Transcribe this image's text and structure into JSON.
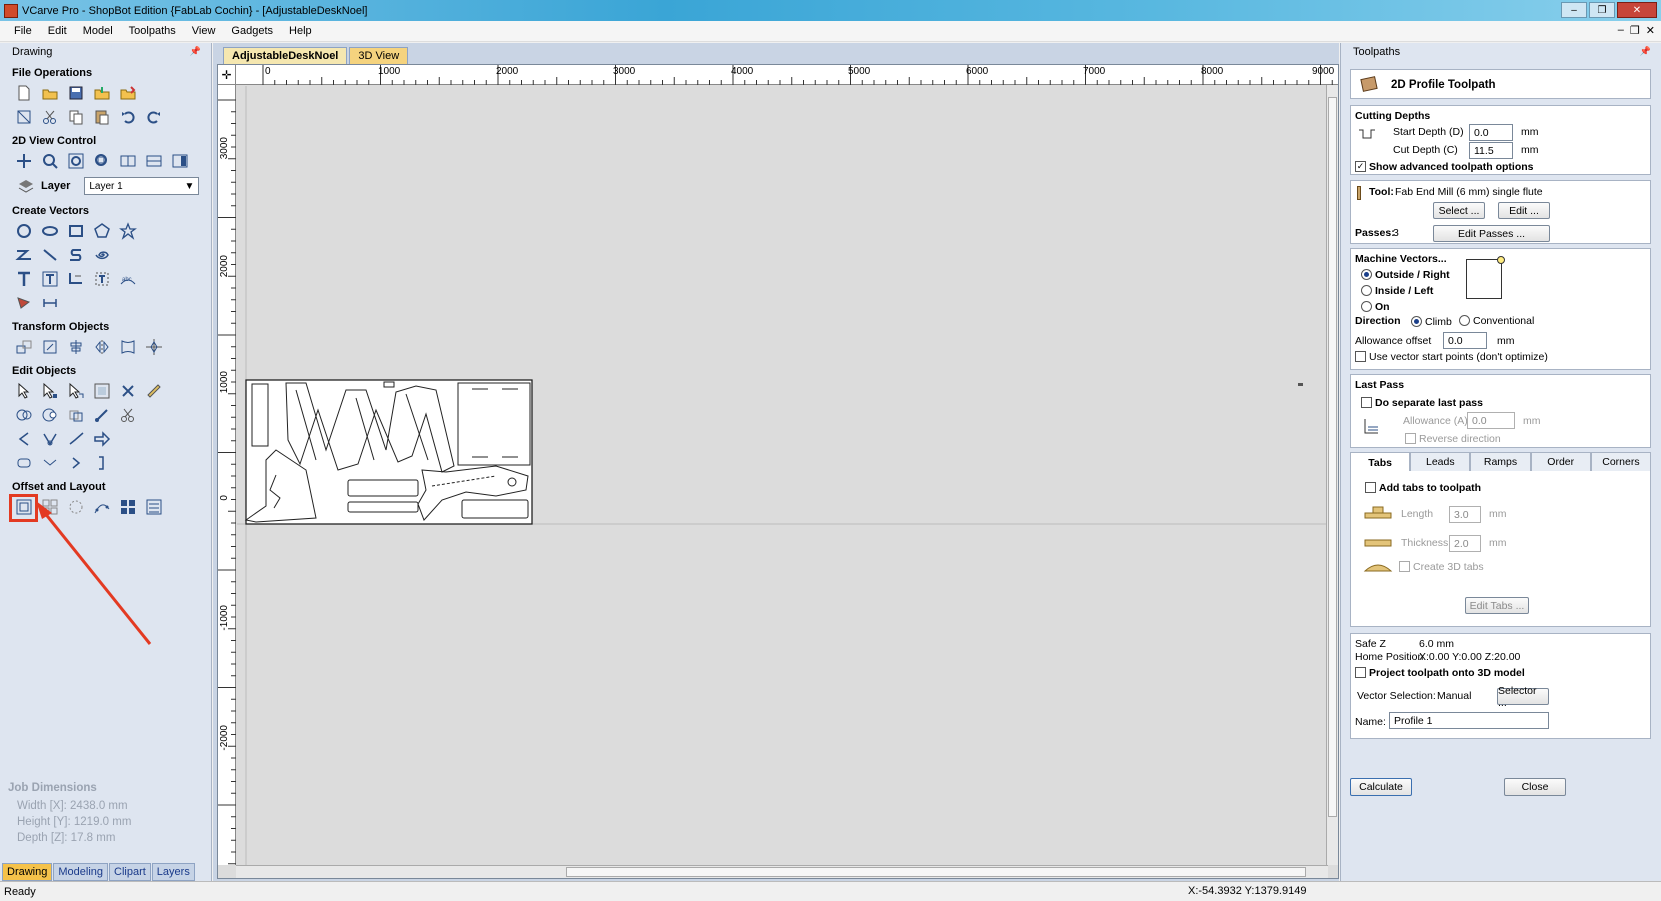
{
  "window": {
    "title": "VCarve Pro - ShopBot Edition {FabLab Cochin} - [AdjustableDeskNoel]",
    "minimize": "–",
    "maximize": "❐",
    "close": "✕"
  },
  "menubar": {
    "items": [
      "File",
      "Edit",
      "Model",
      "Toolpaths",
      "View",
      "Gadgets",
      "Help"
    ],
    "mdi_minimize": "–",
    "mdi_restore": "❐",
    "mdi_close": "✕"
  },
  "left_panel": {
    "header": "Drawing",
    "pin": "📌",
    "sections": {
      "file_operations": "File Operations",
      "view_control": "2D View Control",
      "create_vectors": "Create Vectors",
      "transform_objects": "Transform Objects",
      "edit_objects": "Edit Objects",
      "offset_layout": "Offset and Layout"
    },
    "layer_label": "Layer",
    "layer_value": "Layer 1",
    "job_dimensions": {
      "title": "Job Dimensions",
      "width": "Width  [X]: 2438.0 mm",
      "height": "Height [Y]: 1219.0 mm",
      "depth": "Depth  [Z]: 17.8 mm"
    },
    "tabs": [
      "Drawing",
      "Modeling",
      "Clipart",
      "Layers"
    ]
  },
  "workspace": {
    "doc_tabs": [
      "AdjustableDeskNoel",
      "3D View"
    ],
    "hruler_labels": [
      "0",
      "1000",
      "2000",
      "3000",
      "4000",
      "5000",
      "6000",
      "7000",
      "8000",
      "9000"
    ],
    "vruler_labels": [
      "3000",
      "2000",
      "1000",
      "0",
      "-1000",
      "-2000"
    ],
    "corner_symbol": "✛"
  },
  "right_panel": {
    "header": "Toolpaths",
    "pin": "📌",
    "toolpath_title": "2D Profile Toolpath",
    "cutting_depths": {
      "title": "Cutting Depths",
      "start_label": "Start Depth (D)",
      "start_value": "0.0",
      "cut_label": "Cut Depth (C)",
      "cut_value": "11.5",
      "unit": "mm",
      "advanced_label": "Show advanced toolpath options",
      "advanced_checked": "✓"
    },
    "tool": {
      "label": "Tool:",
      "name": "Fab End Mill (6 mm) single flute",
      "select_btn": "Select ...",
      "edit_btn": "Edit ...",
      "passes_label": "Passes:",
      "passes_value": "3",
      "edit_passes_btn": "Edit Passes ..."
    },
    "machine_vectors": {
      "title": "Machine Vectors...",
      "outside": "Outside / Right",
      "inside": "Inside / Left",
      "on": "On",
      "direction_label": "Direction",
      "climb": "Climb",
      "conventional": "Conventional",
      "allowance_label": "Allowance offset",
      "allowance_value": "0.0",
      "unit": "mm",
      "start_points": "Use vector start points (don't optimize)"
    },
    "last_pass": {
      "title": "Last Pass",
      "separate": "Do separate last pass",
      "allowance_label": "Allowance (A)",
      "allowance_value": "0.0",
      "unit": "mm",
      "reverse": "Reverse direction"
    },
    "tabs_strip": [
      "Tabs",
      "Leads",
      "Ramps",
      "Order",
      "Corners"
    ],
    "tabs_section": {
      "add_tabs": "Add tabs to toolpath",
      "length_label": "Length",
      "length_value": "3.0",
      "thickness_label": "Thickness",
      "thickness_value": "2.0",
      "unit": "mm",
      "create_3d": "Create 3D tabs",
      "edit_tabs_btn": "Edit Tabs ..."
    },
    "bottom": {
      "safe_z_label": "Safe Z",
      "safe_z_value": "6.0 mm",
      "home_label": "Home Position",
      "home_value": "X:0.00 Y:0.00 Z:20.00",
      "project_label": "Project toolpath onto 3D model",
      "vector_sel_label": "Vector Selection:",
      "vector_sel_value": "Manual",
      "selector_btn": "Selector ...",
      "name_label": "Name:",
      "name_value": "Profile 1",
      "calculate_btn": "Calculate",
      "close_btn": "Close"
    }
  },
  "statusbar": {
    "status": "Ready",
    "coords": "X:-54.3932 Y:1379.9149"
  },
  "colors": {
    "highlight": "#e33a22",
    "panel_bg": "#dee5f0",
    "active_tab": "#f5c24a"
  }
}
